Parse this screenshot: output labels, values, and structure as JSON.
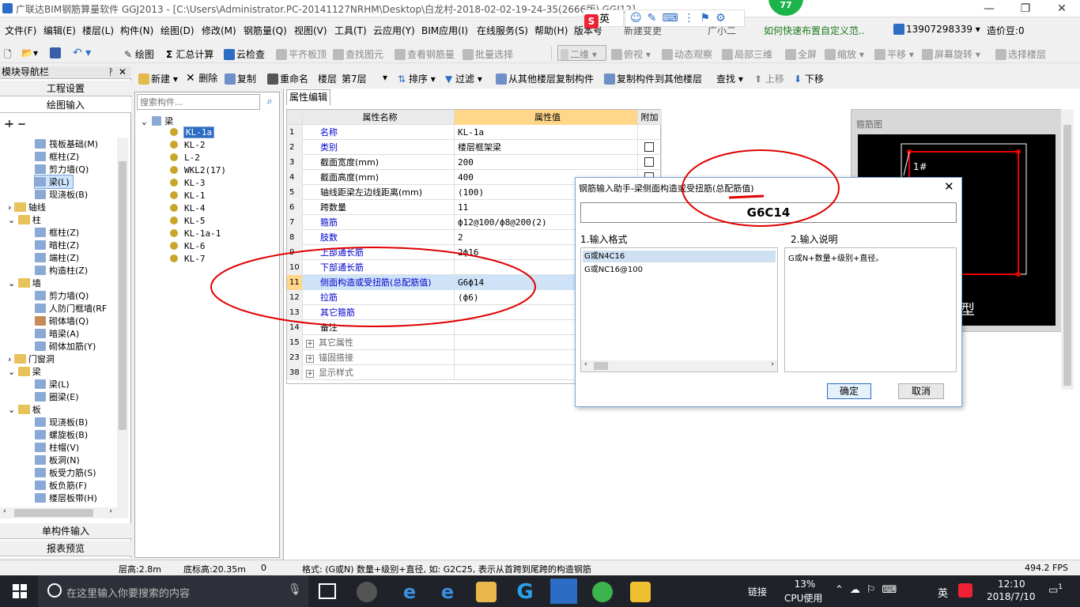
{
  "title": "广联达BIM钢筋算量软件 GGJ2013 - [C:\\Users\\Administrator.PC-20141127NRHM\\Desktop\\白龙村-2018-02-02-19-24-35(2666版).GGJ12]",
  "ime_badge": "英",
  "green_badge": "77",
  "window_btns": {
    "min": "—",
    "max": "❐",
    "close": "✕"
  },
  "menu": [
    "文件(F)",
    "编辑(E)",
    "楼层(L)",
    "构件(N)",
    "绘图(D)",
    "修改(M)",
    "钢筋量(Q)",
    "视图(V)",
    "工具(T)",
    "云应用(Y)",
    "BIM应用(I)",
    "在线服务(S)",
    "帮助(H)",
    "版本号(B)",
    "新建变更",
    "广小二"
  ],
  "menu_right": {
    "tip": "如何快速布置自定义范..",
    "phone": "13907298339",
    "beans": "造价豆:0"
  },
  "toolbar1": {
    "draw": "绘图",
    "sum": "汇总计算",
    "cloud": "云检查",
    "flat": "平齐板顶",
    "find": "查找图元",
    "viewrebar": "查看钢筋量",
    "batch": "批量选择",
    "view2d": "二维",
    "top": "俯视",
    "dyn": "动态观察",
    "local3d": "局部三维",
    "full": "全屏",
    "zoom": "缩放",
    "pan": "平移",
    "rotate": "屏幕旋转",
    "selfloor": "选择楼层"
  },
  "nav": {
    "title": "模块导航栏",
    "project": "工程设置",
    "drawing": "绘图输入",
    "single": "单构件输入",
    "report": "报表预览",
    "items": [
      "筏板基础(M)",
      "框柱(Z)",
      "剪力墙(Q)",
      "梁(L)",
      "现浇板(B)",
      "轴线",
      "柱",
      "框柱(Z)",
      "暗柱(Z)",
      "端柱(Z)",
      "构造柱(Z)",
      "墙",
      "剪力墙(Q)",
      "人防门框墙(RF",
      "砌体墙(Q)",
      "暗梁(A)",
      "砌体加筋(Y)",
      "门窗洞",
      "梁",
      "梁(L)",
      "圈梁(E)",
      "板",
      "现浇板(B)",
      "螺旋板(B)",
      "柱帽(V)",
      "板洞(N)",
      "板受力筋(S)",
      "板负筋(F)",
      "楼层板带(H)"
    ]
  },
  "toolbar2": {
    "new": "新建",
    "del": "删除",
    "copy": "复制",
    "rename": "重命名",
    "floor_label": "楼层",
    "floor": "第7层",
    "sort": "排序",
    "filter": "过滤",
    "copyfrom": "从其他楼层复制构件",
    "copyto": "复制构件到其他楼层",
    "find": "查找",
    "up": "上移",
    "down": "下移"
  },
  "search": {
    "placeholder": "搜索构件..."
  },
  "tree": {
    "root": "梁",
    "items": [
      "KL-1a",
      "KL-2",
      "L-2",
      "WKL2(17)",
      "KL-3",
      "KL-1",
      "KL-4",
      "KL-5",
      "KL-1a-1",
      "KL-6",
      "KL-7"
    ]
  },
  "props": {
    "tab": "属性编辑",
    "col_name": "属性名称",
    "col_value": "属性值",
    "col_extra": "附加",
    "rows": [
      {
        "n": "1",
        "name": "名称",
        "value": "KL-1a",
        "blue": true,
        "chk": false
      },
      {
        "n": "2",
        "name": "类别",
        "value": "楼层框架梁",
        "blue": true,
        "chk": true
      },
      {
        "n": "3",
        "name": "截面宽度(mm)",
        "value": "200",
        "blue": false,
        "chk": true
      },
      {
        "n": "4",
        "name": "截面高度(mm)",
        "value": "400",
        "blue": false,
        "chk": true
      },
      {
        "n": "5",
        "name": "轴线距梁左边线距离(mm)",
        "value": "(100)",
        "blue": false,
        "chk": false
      },
      {
        "n": "6",
        "name": "跨数量",
        "value": "11",
        "blue": false,
        "chk": false
      },
      {
        "n": "7",
        "name": "箍筋",
        "value": "ф12@100/ф8@200(2)",
        "blue": true,
        "chk": false
      },
      {
        "n": "8",
        "name": "肢数",
        "value": "2",
        "blue": true,
        "chk": false
      },
      {
        "n": "9",
        "name": "上部通长筋",
        "value": "2ф16",
        "blue": true,
        "chk": false
      },
      {
        "n": "10",
        "name": "下部通长筋",
        "value": "",
        "blue": true,
        "chk": false
      },
      {
        "n": "11",
        "name": "侧面构造或受扭筋(总配筋值)",
        "value": "G6ф14",
        "blue": true,
        "chk": false
      },
      {
        "n": "12",
        "name": "拉筋",
        "value": "(ф6)",
        "blue": true,
        "chk": false
      },
      {
        "n": "13",
        "name": "其它箍筋",
        "value": "",
        "blue": true,
        "chk": false
      },
      {
        "n": "14",
        "name": "备注",
        "value": "",
        "blue": false,
        "chk": false
      },
      {
        "n": "15",
        "name": "其它属性",
        "value": "",
        "blue": false,
        "chk": false,
        "exp": true
      },
      {
        "n": "23",
        "name": "锚固搭接",
        "value": "",
        "blue": false,
        "chk": false,
        "exp": true
      },
      {
        "n": "38",
        "name": "显示样式",
        "value": "",
        "blue": false,
        "chk": false,
        "exp": true
      }
    ]
  },
  "preview": {
    "title": "箍筋图",
    "label1": "1#",
    "label2": "型"
  },
  "dialog": {
    "title": "钢筋输入助手-梁侧面构造或受扭筋(总配筋值)",
    "value": "G6C14",
    "sec1": "1.输入格式",
    "sec2": "2.输入说明",
    "formats": [
      "G或N4C16",
      "G或NC16@100"
    ],
    "desc": "G或N+数量+级别+直径。",
    "ok": "确定",
    "cancel": "取消"
  },
  "status": {
    "floor_h": "层高:2.8m",
    "base_h": "底标高:20.35m",
    "zero": "0",
    "hint": "格式: (G或N) 数量+级别+直径, 如: G2C25, 表示从首跨到尾跨的构造钢筋",
    "fps": "494.2 FPS"
  },
  "taskbar": {
    "search": "在这里输入你要搜索的内容",
    "link": "链接",
    "cpu": "13%",
    "cpu_label": "CPU使用",
    "lang": "英",
    "time": "12:10",
    "date": "2018/7/10",
    "notif": "1"
  },
  "colors": {
    "accent": "#2b6cc4",
    "selection": "#cde4ff",
    "annotation": "#e00000"
  }
}
